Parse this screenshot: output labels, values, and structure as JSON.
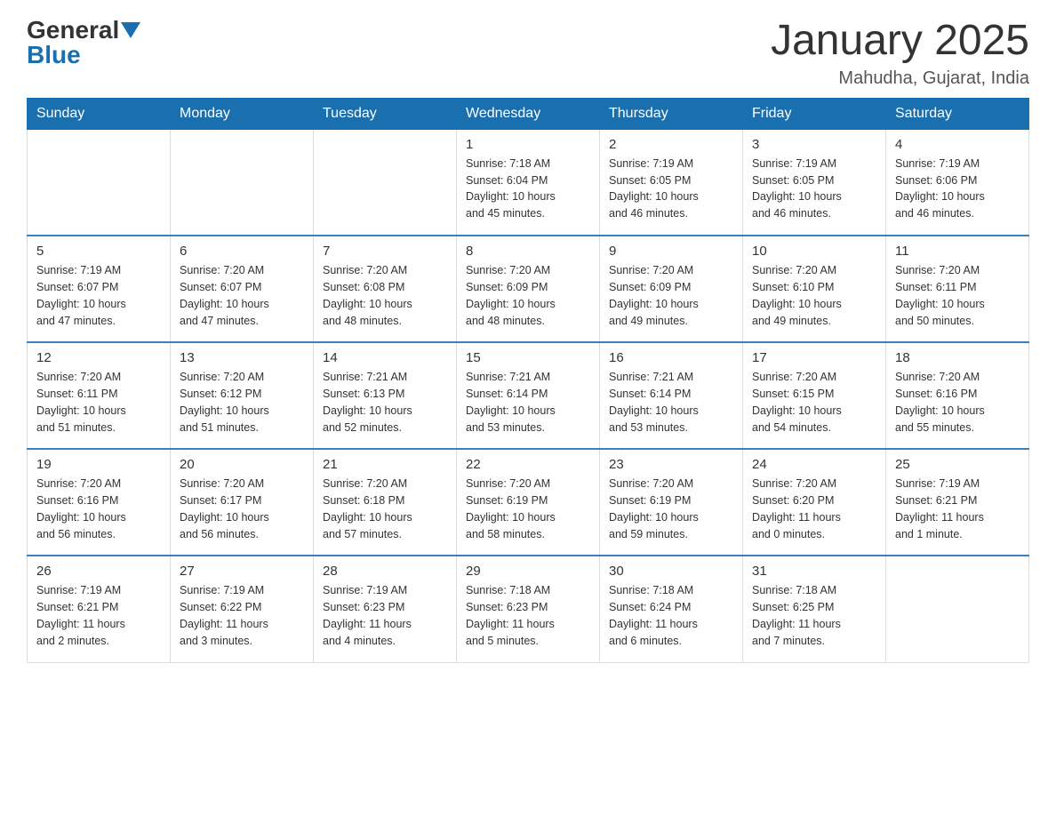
{
  "logo": {
    "general": "General",
    "blue": "Blue"
  },
  "title": "January 2025",
  "location": "Mahudha, Gujarat, India",
  "weekdays": [
    "Sunday",
    "Monday",
    "Tuesday",
    "Wednesday",
    "Thursday",
    "Friday",
    "Saturday"
  ],
  "weeks": [
    [
      {
        "day": "",
        "info": ""
      },
      {
        "day": "",
        "info": ""
      },
      {
        "day": "",
        "info": ""
      },
      {
        "day": "1",
        "info": "Sunrise: 7:18 AM\nSunset: 6:04 PM\nDaylight: 10 hours\nand 45 minutes."
      },
      {
        "day": "2",
        "info": "Sunrise: 7:19 AM\nSunset: 6:05 PM\nDaylight: 10 hours\nand 46 minutes."
      },
      {
        "day": "3",
        "info": "Sunrise: 7:19 AM\nSunset: 6:05 PM\nDaylight: 10 hours\nand 46 minutes."
      },
      {
        "day": "4",
        "info": "Sunrise: 7:19 AM\nSunset: 6:06 PM\nDaylight: 10 hours\nand 46 minutes."
      }
    ],
    [
      {
        "day": "5",
        "info": "Sunrise: 7:19 AM\nSunset: 6:07 PM\nDaylight: 10 hours\nand 47 minutes."
      },
      {
        "day": "6",
        "info": "Sunrise: 7:20 AM\nSunset: 6:07 PM\nDaylight: 10 hours\nand 47 minutes."
      },
      {
        "day": "7",
        "info": "Sunrise: 7:20 AM\nSunset: 6:08 PM\nDaylight: 10 hours\nand 48 minutes."
      },
      {
        "day": "8",
        "info": "Sunrise: 7:20 AM\nSunset: 6:09 PM\nDaylight: 10 hours\nand 48 minutes."
      },
      {
        "day": "9",
        "info": "Sunrise: 7:20 AM\nSunset: 6:09 PM\nDaylight: 10 hours\nand 49 minutes."
      },
      {
        "day": "10",
        "info": "Sunrise: 7:20 AM\nSunset: 6:10 PM\nDaylight: 10 hours\nand 49 minutes."
      },
      {
        "day": "11",
        "info": "Sunrise: 7:20 AM\nSunset: 6:11 PM\nDaylight: 10 hours\nand 50 minutes."
      }
    ],
    [
      {
        "day": "12",
        "info": "Sunrise: 7:20 AM\nSunset: 6:11 PM\nDaylight: 10 hours\nand 51 minutes."
      },
      {
        "day": "13",
        "info": "Sunrise: 7:20 AM\nSunset: 6:12 PM\nDaylight: 10 hours\nand 51 minutes."
      },
      {
        "day": "14",
        "info": "Sunrise: 7:21 AM\nSunset: 6:13 PM\nDaylight: 10 hours\nand 52 minutes."
      },
      {
        "day": "15",
        "info": "Sunrise: 7:21 AM\nSunset: 6:14 PM\nDaylight: 10 hours\nand 53 minutes."
      },
      {
        "day": "16",
        "info": "Sunrise: 7:21 AM\nSunset: 6:14 PM\nDaylight: 10 hours\nand 53 minutes."
      },
      {
        "day": "17",
        "info": "Sunrise: 7:20 AM\nSunset: 6:15 PM\nDaylight: 10 hours\nand 54 minutes."
      },
      {
        "day": "18",
        "info": "Sunrise: 7:20 AM\nSunset: 6:16 PM\nDaylight: 10 hours\nand 55 minutes."
      }
    ],
    [
      {
        "day": "19",
        "info": "Sunrise: 7:20 AM\nSunset: 6:16 PM\nDaylight: 10 hours\nand 56 minutes."
      },
      {
        "day": "20",
        "info": "Sunrise: 7:20 AM\nSunset: 6:17 PM\nDaylight: 10 hours\nand 56 minutes."
      },
      {
        "day": "21",
        "info": "Sunrise: 7:20 AM\nSunset: 6:18 PM\nDaylight: 10 hours\nand 57 minutes."
      },
      {
        "day": "22",
        "info": "Sunrise: 7:20 AM\nSunset: 6:19 PM\nDaylight: 10 hours\nand 58 minutes."
      },
      {
        "day": "23",
        "info": "Sunrise: 7:20 AM\nSunset: 6:19 PM\nDaylight: 10 hours\nand 59 minutes."
      },
      {
        "day": "24",
        "info": "Sunrise: 7:20 AM\nSunset: 6:20 PM\nDaylight: 11 hours\nand 0 minutes."
      },
      {
        "day": "25",
        "info": "Sunrise: 7:19 AM\nSunset: 6:21 PM\nDaylight: 11 hours\nand 1 minute."
      }
    ],
    [
      {
        "day": "26",
        "info": "Sunrise: 7:19 AM\nSunset: 6:21 PM\nDaylight: 11 hours\nand 2 minutes."
      },
      {
        "day": "27",
        "info": "Sunrise: 7:19 AM\nSunset: 6:22 PM\nDaylight: 11 hours\nand 3 minutes."
      },
      {
        "day": "28",
        "info": "Sunrise: 7:19 AM\nSunset: 6:23 PM\nDaylight: 11 hours\nand 4 minutes."
      },
      {
        "day": "29",
        "info": "Sunrise: 7:18 AM\nSunset: 6:23 PM\nDaylight: 11 hours\nand 5 minutes."
      },
      {
        "day": "30",
        "info": "Sunrise: 7:18 AM\nSunset: 6:24 PM\nDaylight: 11 hours\nand 6 minutes."
      },
      {
        "day": "31",
        "info": "Sunrise: 7:18 AM\nSunset: 6:25 PM\nDaylight: 11 hours\nand 7 minutes."
      },
      {
        "day": "",
        "info": ""
      }
    ]
  ]
}
